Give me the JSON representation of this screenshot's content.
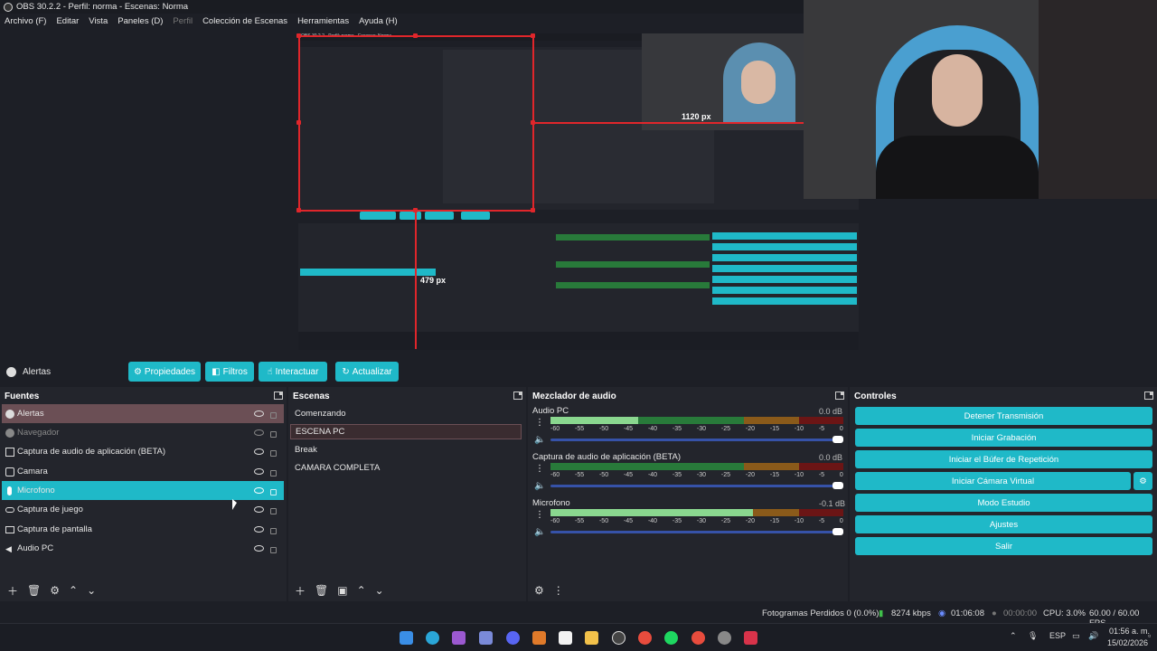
{
  "window": {
    "title": "OBS 30.2.2 - Perfil: norma - Escenas: Norma"
  },
  "menu": [
    "Archivo (F)",
    "Editar",
    "Vista",
    "Paneles (D)",
    "Perfil",
    "Colección de Escenas",
    "Herramientas",
    "Ayuda (H)"
  ],
  "preview": {
    "nested_title": "OBS 30.2.2 - Perfil: norma - Escenas: Norma",
    "width_label": "1120 px",
    "height_label": "479 px"
  },
  "toolbar": {
    "selected_source": "Alertas",
    "properties": "Propiedades",
    "filters": "Filtros",
    "interact": "Interactuar",
    "refresh": "Actualizar"
  },
  "sources": {
    "title": "Fuentes",
    "items": [
      {
        "label": "Alertas",
        "icon": "browser-icon",
        "visible": true
      },
      {
        "label": "Navegador",
        "icon": "browser-icon",
        "visible": false
      },
      {
        "label": "Captura de audio de aplicación (BETA)",
        "icon": "app-audio-icon",
        "visible": true
      },
      {
        "label": "Camara",
        "icon": "camera-icon",
        "visible": true
      },
      {
        "label": "Microfono",
        "icon": "microphone-icon",
        "visible": true
      },
      {
        "label": "Captura de juego",
        "icon": "gamepad-icon",
        "visible": true
      },
      {
        "label": "Captura de pantalla",
        "icon": "monitor-icon",
        "visible": true
      },
      {
        "label": "Audio PC",
        "icon": "speaker-icon",
        "visible": true
      }
    ]
  },
  "scenes": {
    "title": "Escenas",
    "items": [
      "Comenzando",
      "ESCENA PC",
      "Break",
      "CAMARA COMPLETA"
    ]
  },
  "mixer": {
    "title": "Mezclador de audio",
    "channels": [
      {
        "name": "Audio PC",
        "db": "0.0 dB",
        "level": 0.3
      },
      {
        "name": "Captura de audio de aplicación (BETA)",
        "db": "0.0 dB",
        "level": 0
      },
      {
        "name": "Microfono",
        "db": "-0.1 dB",
        "level": 0.69
      }
    ],
    "ticks": [
      "-60",
      "-55",
      "-50",
      "-45",
      "-40",
      "-35",
      "-30",
      "-25",
      "-20",
      "-15",
      "-10",
      "-5",
      "0"
    ]
  },
  "controls": {
    "title": "Controles",
    "buttons": [
      "Detener Transmisión",
      "Iniciar Grabación",
      "Iniciar el Búfer de Repetición",
      "Iniciar Cámara Virtual",
      "Modo Estudio",
      "Ajustes",
      "Salir"
    ]
  },
  "status": {
    "dropped": "Fotogramas Perdidos 0 (0.0%)",
    "bitrate": "8274 kbps",
    "stream_time": "01:06:08",
    "rec_time": "00:00:00",
    "cpu": "CPU: 3.0%",
    "fps": "60.00 / 60.00 FPS"
  },
  "taskbar": {
    "lang": "ESP",
    "time": "01:56 a. m.",
    "date": "15/02/2026"
  },
  "colors": {
    "accent": "#1fb9c8",
    "selection": "#e0262b",
    "panel": "#23252c"
  }
}
